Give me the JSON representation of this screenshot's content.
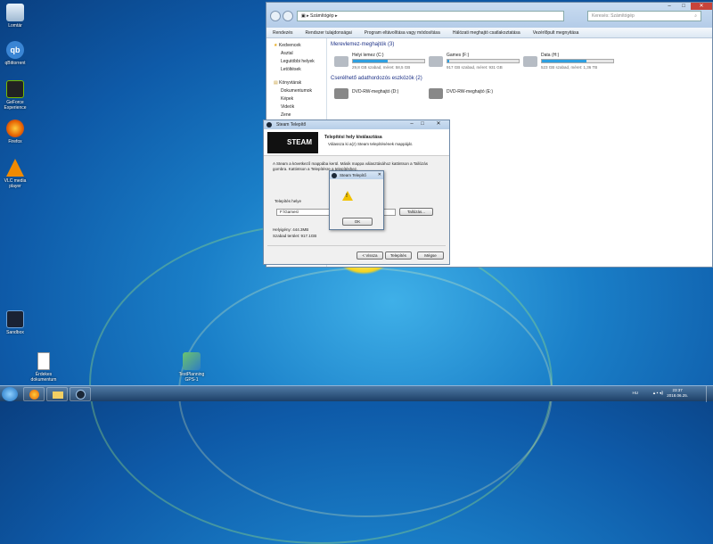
{
  "desktop": {
    "icons": [
      {
        "label": "Lomtár"
      },
      {
        "label": "qBittorrent"
      },
      {
        "label": "GeForce Experience"
      },
      {
        "label": "Firefox"
      },
      {
        "label": "VLC media player"
      },
      {
        "label": "Sandbox"
      },
      {
        "label": "Érdekes dokumentum"
      },
      {
        "label": "TestPlanning GPS-1"
      }
    ]
  },
  "explorer": {
    "address": "Számítógép",
    "search_placeholder": "Keresés: Számítógép",
    "menu": [
      "Rendezés",
      "Rendszer tulajdonságai",
      "Program eltávolítása vagy módosítása",
      "Hálózati meghajtó csatlakoztatása",
      "Vezérlőpult megnyitása"
    ],
    "sidebar": {
      "favorites": "Kedvencek",
      "fav_items": [
        "Asztal",
        "Legutóbbi helyek",
        "Letöltések"
      ],
      "libraries": "Könyvtárak",
      "lib_items": [
        "Dokumentumok",
        "Képek",
        "Videók",
        "Zene"
      ]
    },
    "group_hdd": "Merevlemez-meghajtók (3)",
    "group_removable": "Cserélhető adathordozós eszközök (2)",
    "drives": [
      {
        "name": "Helyi lemez (C:)",
        "space": "29,8 GB szabad, méret: 58,5 GB",
        "used": 0.49
      },
      {
        "name": "Games (F:)",
        "space": "917 GB szabad, méret: 931 GB",
        "used": 0.015
      },
      {
        "name": "Data (H:)",
        "space": "523 GB szabad, méret: 1,36 TB",
        "used": 0.62
      }
    ],
    "dvd": [
      "DVD-RW-meghajtó (D:)",
      "DVD-RW-meghajtó (E:)"
    ]
  },
  "steam": {
    "title": "Steam Telepítő",
    "logo": "STEAM",
    "heading": "Telepítési hely kiválasztása",
    "subheading": "Válassza ki a(z) Steam telepítésének mappáját.",
    "body": "A Steam a következő mappába kerül. Másik mappa választásához kattintson a Tallózás gombra. Kattintson a Telepítésre a telepítéshez.",
    "folder_label": "Telepítés helye",
    "folder_value": "F:\\Games\\",
    "browse": "Tallózás...",
    "space_required": "Helyigény: 444.3MB",
    "space_available": "Szabad terület: 917.1GB",
    "back": "< Vissza",
    "install": "Telepítés",
    "cancel": "Mégse"
  },
  "warning": {
    "title": "Steam Telepítő",
    "ok": "OK"
  },
  "taskbar": {
    "lang": "HU",
    "time": "23:37",
    "date": "2018.06.25."
  }
}
